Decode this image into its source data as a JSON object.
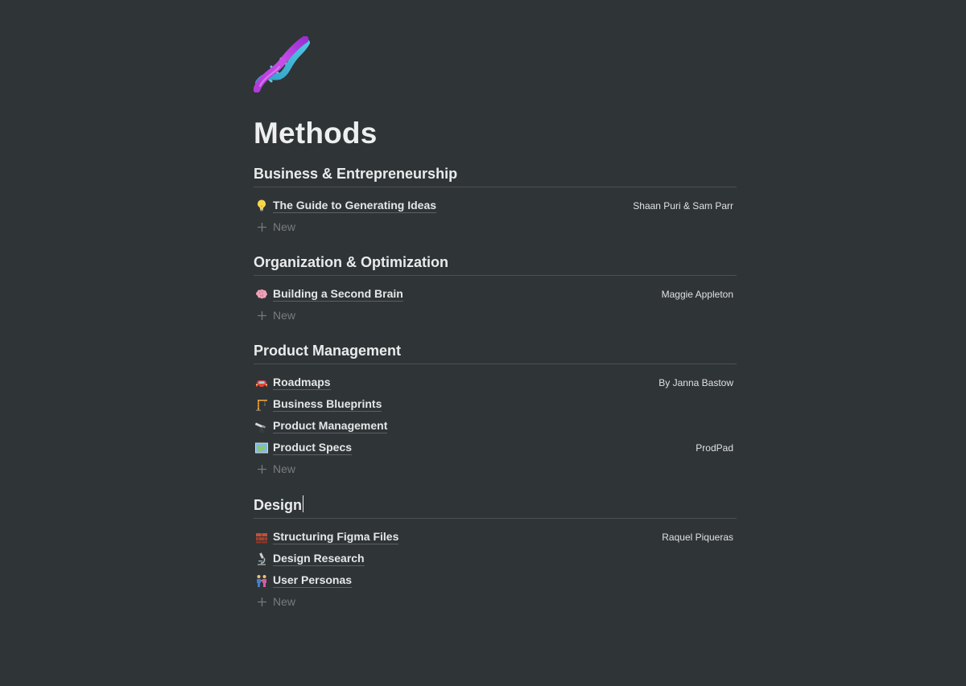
{
  "page": {
    "icon": "dna-icon",
    "title": "Methods"
  },
  "groups": [
    {
      "heading": "Business & Entrepreneurship",
      "rows": [
        {
          "icon": "lightbulb-icon",
          "title": "The Guide to Generating Ideas",
          "meta": "Shaan Puri & Sam Parr"
        }
      ],
      "new_label": "New"
    },
    {
      "heading": "Organization & Optimization",
      "rows": [
        {
          "icon": "brain-icon",
          "title": "Building a Second Brain",
          "meta": "Maggie Appleton"
        }
      ],
      "new_label": "New"
    },
    {
      "heading": "Product Management",
      "rows": [
        {
          "icon": "car-icon",
          "title": "Roadmaps",
          "meta": "By Janna Bastow"
        },
        {
          "icon": "crane-icon",
          "title": "Business Blueprints",
          "meta": ""
        },
        {
          "icon": "telescope-icon",
          "title": "Product Management",
          "meta": ""
        },
        {
          "icon": "map-icon",
          "title": "Product Specs",
          "meta": "ProdPad"
        }
      ],
      "new_label": "New"
    },
    {
      "heading": "Design",
      "rows": [
        {
          "icon": "bricks-icon",
          "title": "Structuring Figma Files",
          "meta": "Raquel Piqueras"
        },
        {
          "icon": "microscope-icon",
          "title": "Design Research",
          "meta": ""
        },
        {
          "icon": "people-icon",
          "title": "User Personas",
          "meta": ""
        }
      ],
      "new_label": "New"
    }
  ]
}
